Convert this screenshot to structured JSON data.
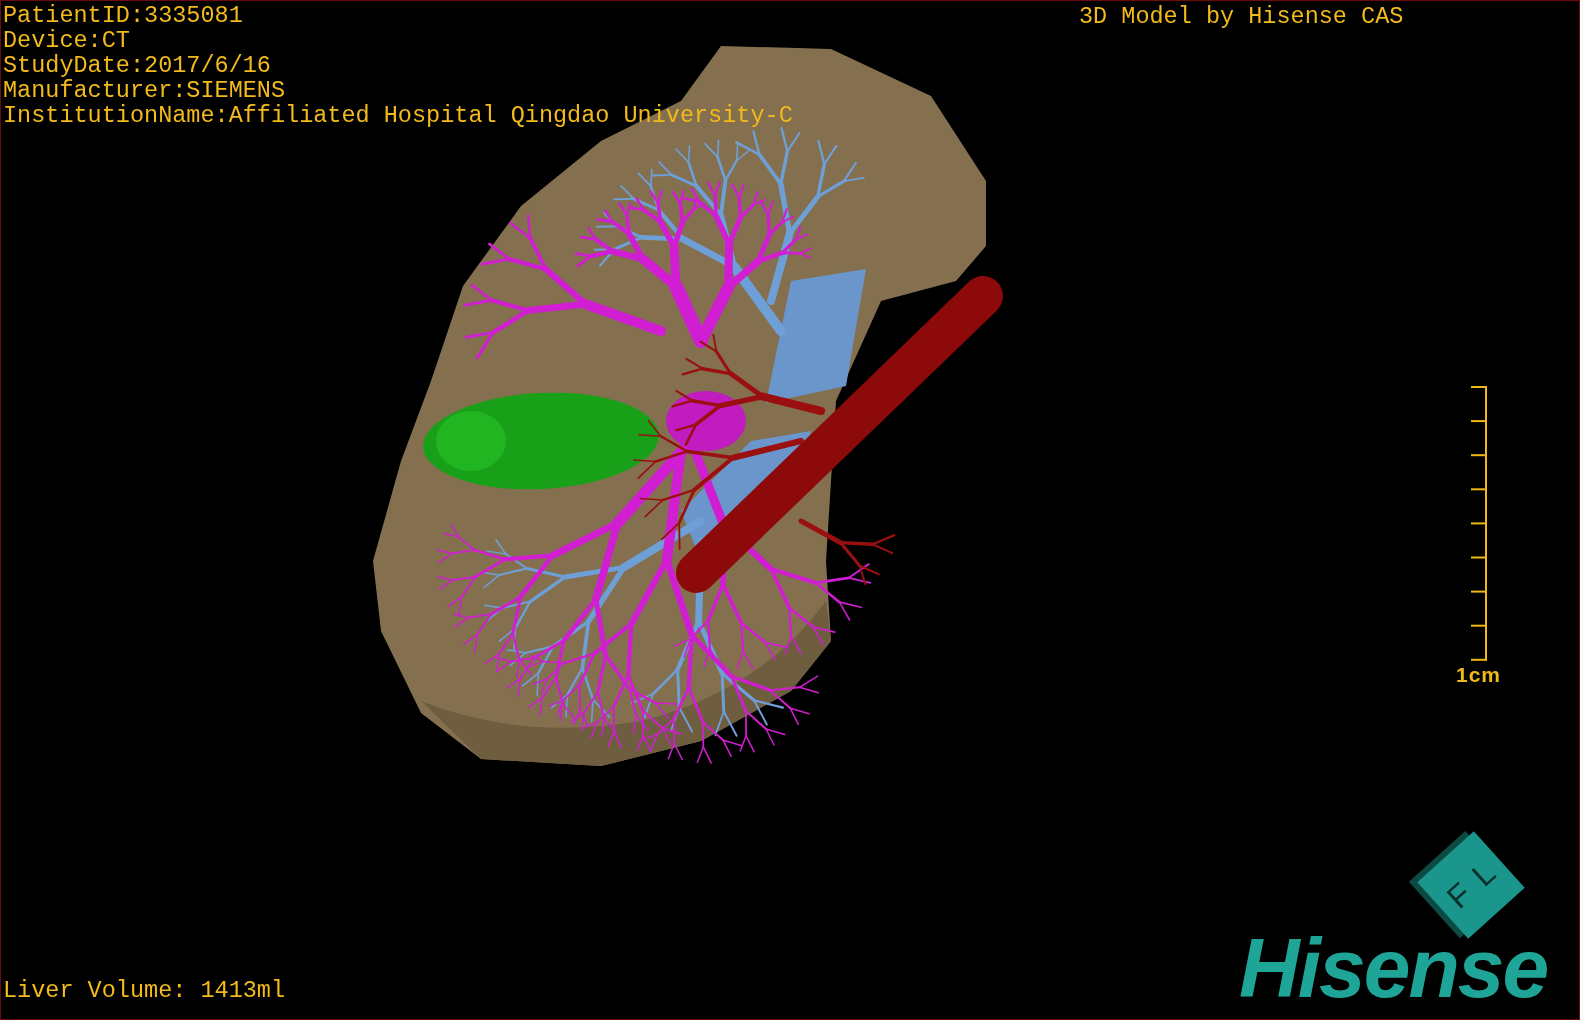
{
  "viewport": {
    "patient_info": [
      "PatientID:3335081",
      "Device:CT",
      "StudyDate:2017/6/16",
      "Manufacturer:SIEMENS",
      "InstitutionName:Affiliated Hospital Qingdao University-C"
    ],
    "title": "3D Model by Hisense CAS",
    "scale_bar": {
      "label": "1cm"
    },
    "orientation_cube": {
      "faces": [
        "F",
        "L"
      ]
    },
    "logo": "Hisense",
    "liver_volume": "Liver Volume: 1413ml"
  }
}
